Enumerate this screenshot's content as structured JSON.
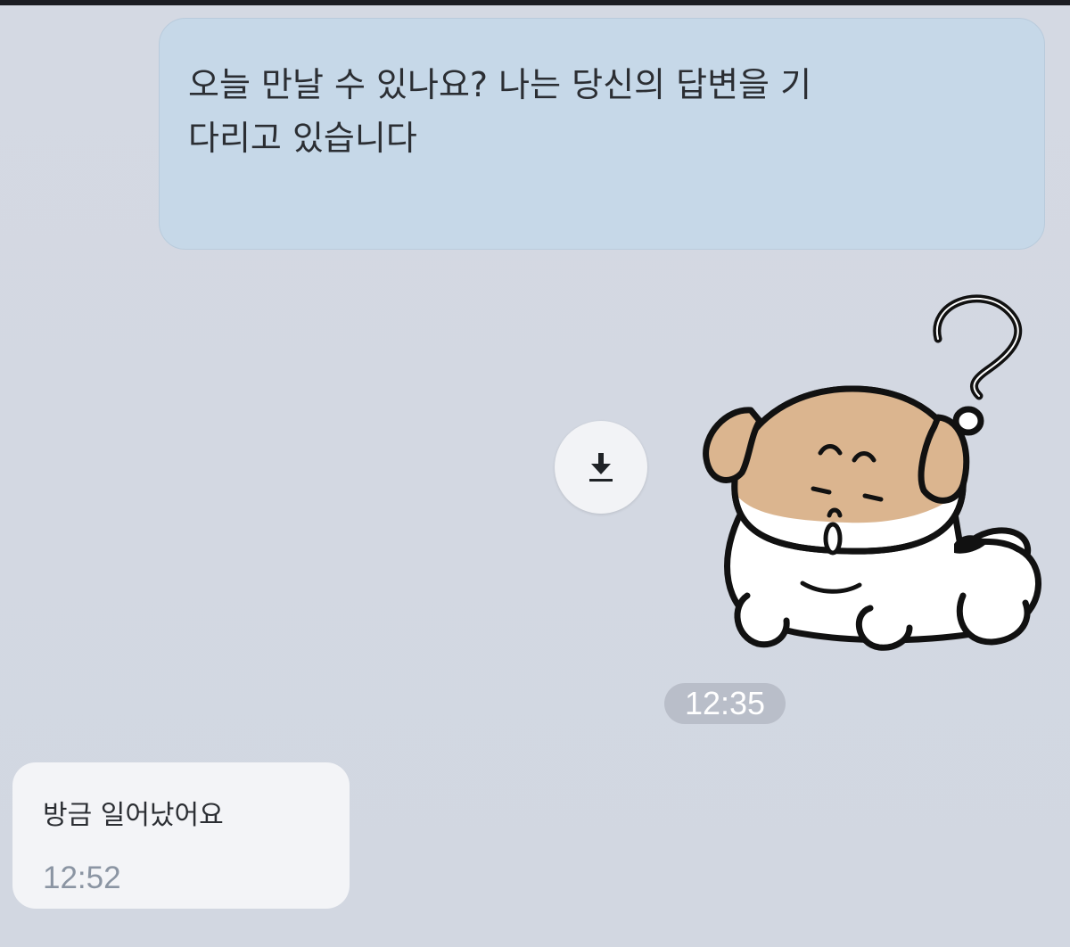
{
  "messages": {
    "outgoing_text": "오늘 만날 수 있나요? 나는 당신의 답변을 기다리고 있습니다",
    "sticker_timestamp": "12:35",
    "incoming_text": "방금 일어났어요",
    "incoming_timestamp": "12:52"
  },
  "icons": {
    "download": "download-icon",
    "sticker": "puppy-question-sticker"
  },
  "colors": {
    "background": "#d3d8e2",
    "outgoing_bubble": "#c6d8e8",
    "incoming_bubble": "#f3f4f7",
    "timestamp_pill": "#b9bec9",
    "sticker_fur": "#dbb58f"
  }
}
